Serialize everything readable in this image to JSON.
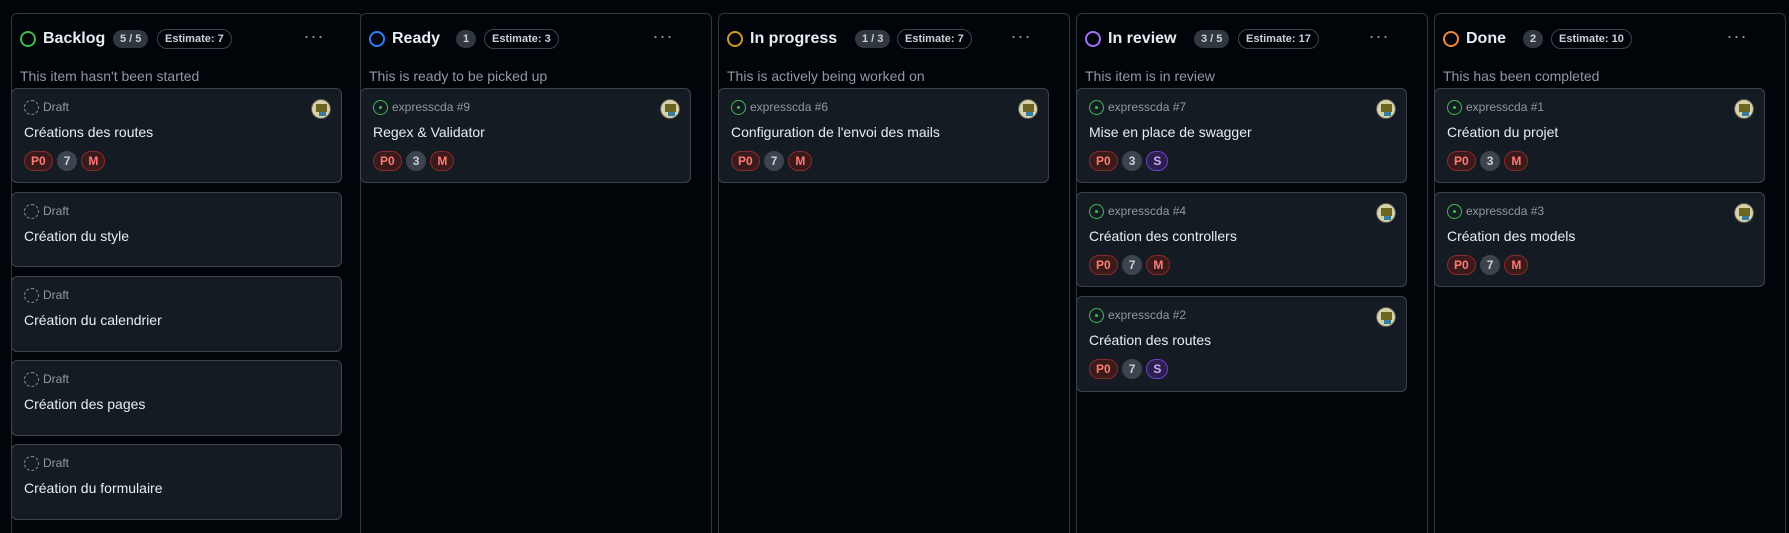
{
  "columns": [
    {
      "title": "Backlog",
      "count": "5 / 5",
      "estimate": "Estimate: 7",
      "description": "This item hasn't been started",
      "color": "#3fb950",
      "cards": [
        {
          "ref": "Draft",
          "title": "Créations des routes",
          "labels": [
            "P0",
            "7",
            "M"
          ]
        },
        {
          "ref": "Draft",
          "title": "Création du style"
        },
        {
          "ref": "Draft",
          "title": "Création du calendrier"
        },
        {
          "ref": "Draft",
          "title": "Création des pages"
        },
        {
          "ref": "Draft",
          "title": "Création du formulaire"
        }
      ]
    },
    {
      "title": "Ready",
      "count": "1",
      "estimate": "Estimate: 3",
      "description": "This is ready to be picked up",
      "color": "#2f81f7",
      "cards": [
        {
          "ref": "expresscda #9",
          "title": "Regex & Validator",
          "labels": [
            "P0",
            "3",
            "M"
          ]
        }
      ]
    },
    {
      "title": "In progress",
      "count": "1 / 3",
      "estimate": "Estimate: 7",
      "description": "This is actively being worked on",
      "color": "#d29922",
      "cards": [
        {
          "ref": "expresscda #6",
          "title": "Configuration de l'envoi des mails",
          "labels": [
            "P0",
            "7",
            "M"
          ]
        }
      ]
    },
    {
      "title": "In review",
      "count": "3 / 5",
      "estimate": "Estimate: 17",
      "description": "This item is in review",
      "color": "#a371f7",
      "cards": [
        {
          "ref": "expresscda #7",
          "title": "Mise en place de swagger",
          "labels": [
            "P0",
            "3",
            "S"
          ]
        },
        {
          "ref": "expresscda #4",
          "title": "Création des controllers",
          "labels": [
            "P0",
            "7",
            "M"
          ]
        },
        {
          "ref": "expresscda #2",
          "title": "Création des routes",
          "labels": [
            "P0",
            "7",
            "S"
          ]
        }
      ]
    },
    {
      "title": "Done",
      "count": "2",
      "estimate": "Estimate: 10",
      "description": "This has been completed",
      "color": "#f0883e",
      "cards": [
        {
          "ref": "expresscda #1",
          "title": "Création du projet",
          "labels": [
            "P0",
            "3",
            "M"
          ]
        },
        {
          "ref": "expresscda #3",
          "title": "Création des models",
          "labels": [
            "P0",
            "7",
            "M"
          ]
        }
      ]
    }
  ],
  "more_glyph": "···",
  "icons": {
    "column_status": "status-circle-icon",
    "draft": "draft-icon",
    "issue": "issue-opened-icon",
    "avatar": "user-avatar",
    "more": "kebab-horizontal-icon"
  }
}
